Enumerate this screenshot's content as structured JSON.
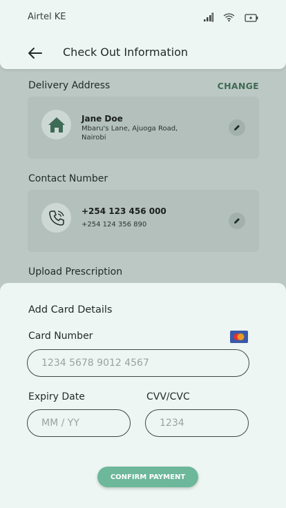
{
  "status_bar": {
    "carrier": "Airtel KE"
  },
  "header": {
    "title": "Check Out Information"
  },
  "delivery": {
    "label": "Delivery Address",
    "change_label": "CHANGE",
    "name": "Jane Doe",
    "address": "Mbaru's Lane, Ajuoga Road, Nairobi"
  },
  "contact": {
    "label": "Contact Number",
    "primary": "+254 123 456 000",
    "secondary": "+254 124 356 890"
  },
  "prescription": {
    "label": "Upload Prescription"
  },
  "card_sheet": {
    "title": "Add Card Details",
    "card_number_label": "Card Number",
    "card_number_placeholder": "1234 5678 9012 4567",
    "expiry_label": "Expiry Date",
    "expiry_placeholder": "MM / YY",
    "cvv_label": "CVV/CVC",
    "cvv_placeholder": "1234",
    "confirm_label": "CONFIRM PAYMENT"
  },
  "colors": {
    "accent": "#6db79a",
    "change_text": "#3f6a55",
    "overlay_bg": "#bcc8c3",
    "sheet_bg": "#eef6f3"
  },
  "icons": [
    "back-arrow-icon",
    "signal-icon",
    "wifi-icon",
    "battery-icon",
    "home-icon",
    "phone-icon",
    "edit-icon",
    "mastercard-icon"
  ]
}
